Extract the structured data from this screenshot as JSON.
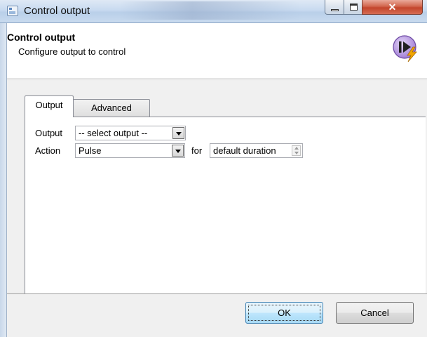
{
  "window": {
    "title": "Control output",
    "icon": "window-dialog-icon",
    "controls": {
      "minimize": "minimize-icon",
      "maximize": "maximize-icon",
      "close": "close-icon"
    }
  },
  "header": {
    "title": "Control output",
    "subtitle": "Configure output to control",
    "icon": "play-lightning-icon",
    "icon_colors": {
      "disc": "#b99be0",
      "bolt": "#f2a600"
    }
  },
  "tabs": [
    {
      "label": "Output",
      "active": true
    },
    {
      "label": "Advanced",
      "active": false
    }
  ],
  "form": {
    "output_label": "Output",
    "output_value": "-- select output --",
    "action_label": "Action",
    "action_value": "Pulse",
    "for_label": "for",
    "duration_value": "default duration"
  },
  "buttons": {
    "ok": "OK",
    "cancel": "Cancel"
  }
}
